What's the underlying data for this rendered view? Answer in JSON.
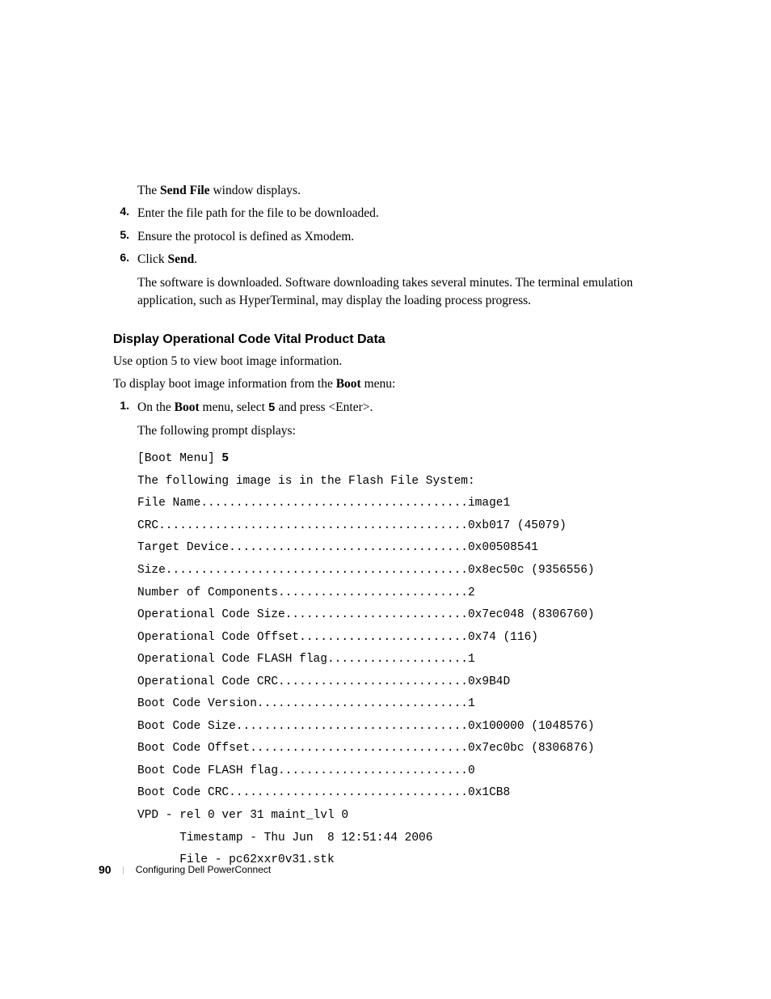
{
  "intro_para": {
    "pre": "The ",
    "bold": "Send File",
    "post": " window displays."
  },
  "steps": [
    {
      "num": "4.",
      "text": "Enter the file path for the file to be downloaded."
    },
    {
      "num": "5.",
      "text": "Ensure the protocol is defined as Xmodem."
    },
    {
      "num": "6.",
      "pre": "Click ",
      "bold": "Send",
      "post": ".",
      "sub": "The software is downloaded. Software downloading takes several minutes. The terminal emulation application, such as HyperTerminal, may display the loading process progress."
    }
  ],
  "heading": "Display Operational Code Vital Product Data",
  "body1": "Use option 5 to view boot image information.",
  "body2_pre": "To display boot image information from the ",
  "body2_bold": "Boot",
  "body2_post": " menu:",
  "step1": {
    "num": "1.",
    "pre": "On the ",
    "bold1": "Boot",
    "mid": " menu, select ",
    "bold2": "5",
    "post": " and press <Enter>.",
    "sub": "The following prompt displays:"
  },
  "mono": {
    "line0a": "[Boot Menu] ",
    "line0b": "5",
    "lines": [
      "The following image is in the Flash File System:",
      "File Name......................................image1",
      "CRC............................................0xb017 (45079)",
      "Target Device..................................0x00508541",
      "Size...........................................0x8ec50c (9356556)",
      "Number of Components...........................2",
      "Operational Code Size..........................0x7ec048 (8306760)",
      "Operational Code Offset........................0x74 (116)",
      "Operational Code FLASH flag....................1",
      "Operational Code CRC...........................0x9B4D",
      "Boot Code Version..............................1",
      "Boot Code Size.................................0x100000 (1048576)",
      "Boot Code Offset...............................0x7ec0bc (8306876)",
      "Boot Code FLASH flag...........................0",
      "Boot Code CRC..................................0x1CB8",
      "VPD - rel 0 ver 31 maint_lvl 0",
      "      Timestamp - Thu Jun  8 12:51:44 2006",
      "      File - pc62xxr0v31.stk"
    ]
  },
  "footer": {
    "page": "90",
    "sep": "|",
    "title": "Configuring Dell PowerConnect"
  }
}
